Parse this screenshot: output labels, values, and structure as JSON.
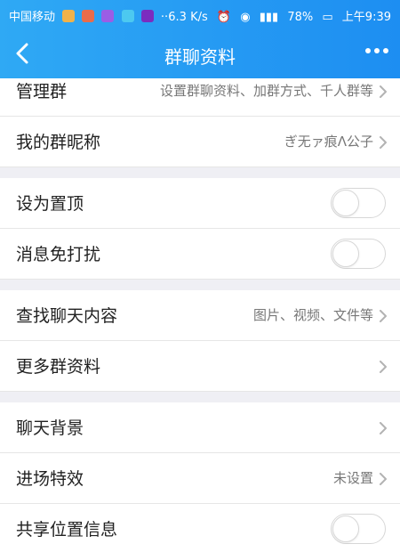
{
  "status_bar": {
    "carrier": "中国移动",
    "speed": "6.3 K/s",
    "battery": "78%",
    "time": "上午9:39",
    "icons": [
      "app-icon-1",
      "app-icon-2",
      "app-icon-3",
      "app-icon-4",
      "app-icon-5",
      "overflow-dots",
      "alarm-icon",
      "eye-icon",
      "signal-icon",
      "battery-icon"
    ]
  },
  "header": {
    "title": "群聊资料",
    "back_icon": "chevron-left-icon",
    "more_icon": "more-dots-icon",
    "color": "#2196f3"
  },
  "rows": [
    {
      "label": "管理群",
      "value": "设置群聊资料、加群方式、千人群等",
      "chevron": true
    },
    {
      "label": "我的群昵称",
      "value": "ぎ无ァ痕Λ公子",
      "chevron": true
    },
    {
      "label": "设为置顶",
      "toggle": false
    },
    {
      "label": "消息免打扰",
      "toggle": false
    },
    {
      "label": "查找聊天内容",
      "value": "图片、视频、文件等",
      "chevron": true
    },
    {
      "label": "更多群资料",
      "value": "",
      "chevron": true
    },
    {
      "label": "聊天背景",
      "value": "",
      "chevron": true
    },
    {
      "label": "进场特效",
      "value": "未设置",
      "chevron": true
    },
    {
      "label": "共享位置信息",
      "toggle": false
    }
  ]
}
